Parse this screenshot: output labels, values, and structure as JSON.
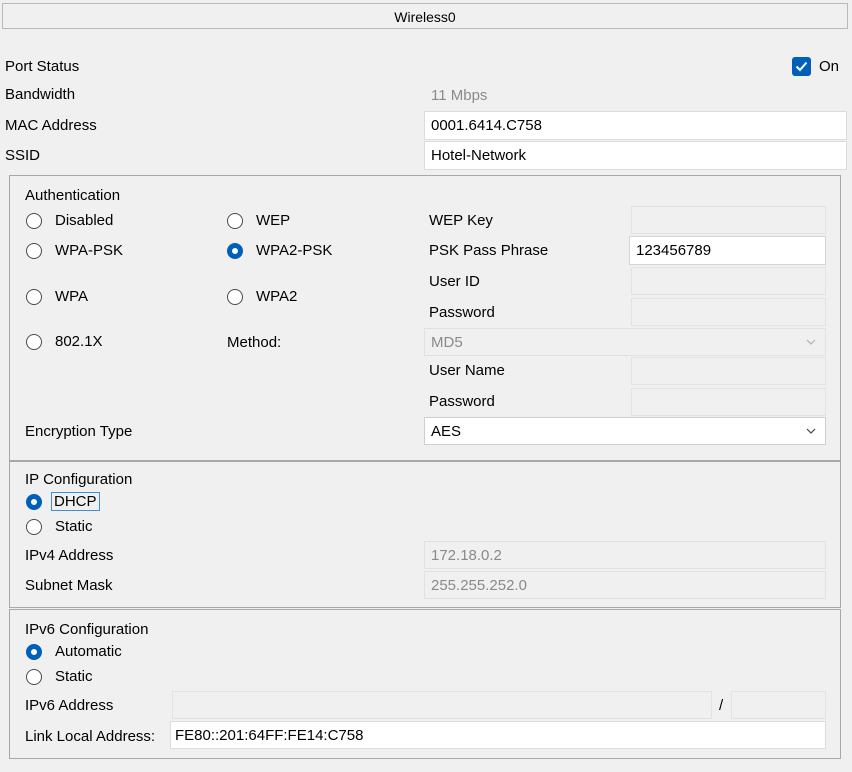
{
  "window": {
    "title": "Wireless0"
  },
  "port": {
    "status_label": "Port Status",
    "on_label": "On",
    "on_checked": true,
    "bandwidth_label": "Bandwidth",
    "bandwidth_value": "11 Mbps",
    "mac_label": "MAC Address",
    "mac_value": "0001.6414.C758",
    "ssid_label": "SSID",
    "ssid_value": "Hotel-Network"
  },
  "auth": {
    "group_label": "Authentication",
    "options": {
      "disabled": "Disabled",
      "wep": "WEP",
      "wpa_psk": "WPA-PSK",
      "wpa2_psk": "WPA2-PSK",
      "wpa": "WPA",
      "wpa2": "WPA2",
      "x8021": "802.1X"
    },
    "selected": "WPA2-PSK",
    "wep_key_label": "WEP Key",
    "wep_key_value": "",
    "psk_label": "PSK Pass Phrase",
    "psk_value": "123456789",
    "user_id_label": "User ID",
    "password_label": "Password",
    "method_label": "Method:",
    "method_value": "MD5",
    "user_name_label": "User Name",
    "password2_label": "Password",
    "encryption_label": "Encryption Type",
    "encryption_value": "AES"
  },
  "ip": {
    "group_label": "IP Configuration",
    "dhcp_label": "DHCP",
    "static_label": "Static",
    "selected": "DHCP",
    "ipv4_label": "IPv4 Address",
    "ipv4_value": "172.18.0.2",
    "subnet_label": "Subnet Mask",
    "subnet_value": "255.255.252.0"
  },
  "ipv6": {
    "group_label": "IPv6 Configuration",
    "automatic_label": "Automatic",
    "static_label": "Static",
    "selected": "Automatic",
    "address_label": "IPv6 Address",
    "address_value": "",
    "prefix_sep": "/",
    "prefix_value": "",
    "link_local_label": "Link Local Address:",
    "link_local_value": "FE80::201:64FF:FE14:C758"
  },
  "icons": {
    "checkmark": "check-icon",
    "dropdown": "chevron-down-icon"
  },
  "colors": {
    "accent": "#005fb8"
  }
}
